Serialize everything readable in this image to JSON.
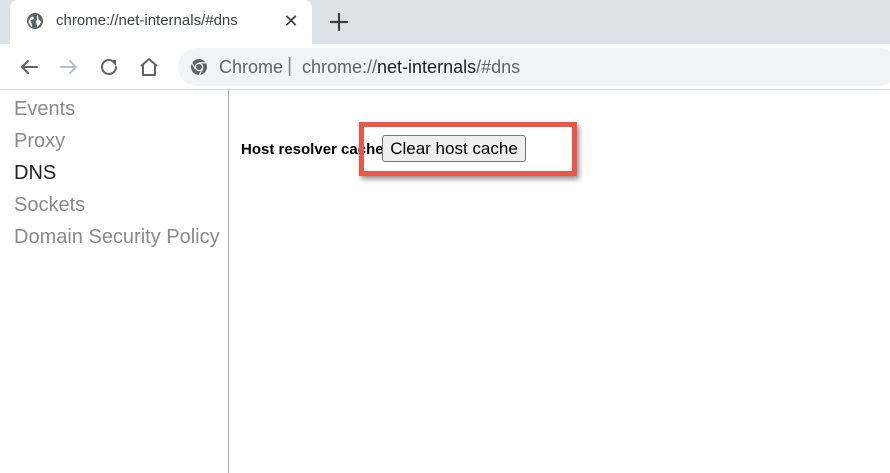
{
  "tab": {
    "title": "chrome://net-internals/#dns"
  },
  "omnibox": {
    "site_label": "Chrome",
    "separator": "|",
    "url_scheme": "chrome://",
    "url_host": "net-internals",
    "url_path": "/#dns"
  },
  "sidebar": {
    "items": [
      {
        "label": "Events"
      },
      {
        "label": "Proxy"
      },
      {
        "label": "DNS"
      },
      {
        "label": "Sockets"
      },
      {
        "label": "Domain Security Policy"
      }
    ]
  },
  "dns": {
    "host_resolver_label": "Host resolver cache",
    "clear_button_label": "Clear host cache"
  },
  "colors": {
    "highlight": "#e8584a",
    "tabstrip": "#dee1e6"
  }
}
